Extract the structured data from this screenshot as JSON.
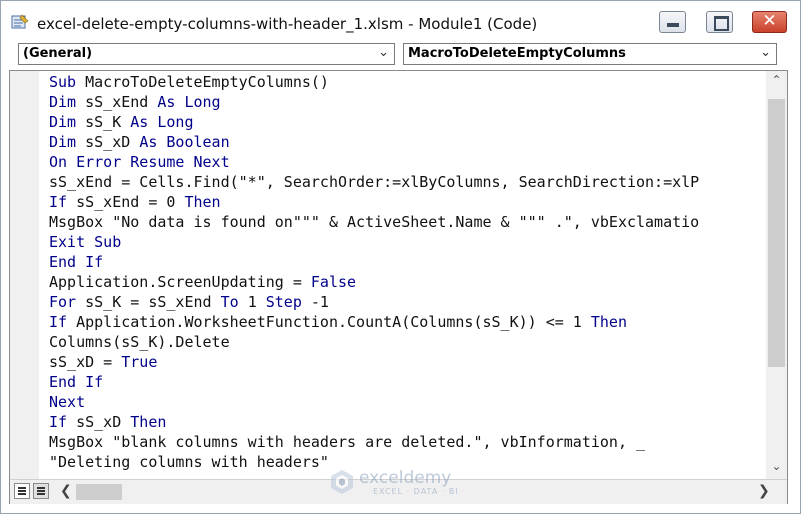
{
  "window": {
    "title": "excel-delete-empty-columns-with-header_1.xlsm - Module1 (Code)",
    "buttons": {
      "minimize": "minimize",
      "maximize": "maximize",
      "close": "✕"
    }
  },
  "dropdowns": {
    "object": "(General)",
    "procedure": "MacroToDeleteEmptyColumns"
  },
  "code_lines": [
    [
      {
        "t": "Sub ",
        "k": true
      },
      {
        "t": "MacroToDeleteEmptyColumns()"
      }
    ],
    [
      {
        "t": "Dim ",
        "k": true
      },
      {
        "t": "sS_xEnd "
      },
      {
        "t": "As Long",
        "k": true
      }
    ],
    [
      {
        "t": "Dim ",
        "k": true
      },
      {
        "t": "sS_K "
      },
      {
        "t": "As Long",
        "k": true
      }
    ],
    [
      {
        "t": "Dim ",
        "k": true
      },
      {
        "t": "sS_xD "
      },
      {
        "t": "As Boolean",
        "k": true
      }
    ],
    [
      {
        "t": "On Error Resume Next",
        "k": true
      }
    ],
    [
      {
        "t": "sS_xEnd = Cells.Find(\"*\", SearchOrder:=xlByColumns, SearchDirection:=xlP"
      }
    ],
    [
      {
        "t": "If ",
        "k": true
      },
      {
        "t": "sS_xEnd = 0 "
      },
      {
        "t": "Then",
        "k": true
      }
    ],
    [
      {
        "t": "MsgBox \"No data is found on\"\"\" & ActiveSheet.Name & \"\"\" .\", vbExclamatio"
      }
    ],
    [
      {
        "t": "Exit Sub",
        "k": true
      }
    ],
    [
      {
        "t": "End If",
        "k": true
      }
    ],
    [
      {
        "t": "Application.ScreenUpdating = "
      },
      {
        "t": "False",
        "k": true
      }
    ],
    [
      {
        "t": "For ",
        "k": true
      },
      {
        "t": "sS_K = sS_xEnd "
      },
      {
        "t": "To ",
        "k": true
      },
      {
        "t": "1 "
      },
      {
        "t": "Step ",
        "k": true
      },
      {
        "t": "-1"
      }
    ],
    [
      {
        "t": "If ",
        "k": true
      },
      {
        "t": "Application.WorksheetFunction.CountA(Columns(sS_K)) <= 1 "
      },
      {
        "t": "Then",
        "k": true
      }
    ],
    [
      {
        "t": "Columns(sS_K).Delete"
      }
    ],
    [
      {
        "t": "sS_xD = "
      },
      {
        "t": "True",
        "k": true
      }
    ],
    [
      {
        "t": "End If",
        "k": true
      }
    ],
    [
      {
        "t": "Next",
        "k": true
      }
    ],
    [
      {
        "t": "If ",
        "k": true
      },
      {
        "t": "sS_xD "
      },
      {
        "t": "Then",
        "k": true
      }
    ],
    [
      {
        "t": "MsgBox \"blank columns with headers are deleted.\", vbInformation, _"
      }
    ],
    [
      {
        "t": "\"Deleting columns with headers\""
      }
    ]
  ],
  "watermark": {
    "name": "exceldemy",
    "tagline": "EXCEL · DATA · BI"
  },
  "colors": {
    "keyword": "#00008b",
    "text": "#111111",
    "close_button": "#c9402a"
  }
}
